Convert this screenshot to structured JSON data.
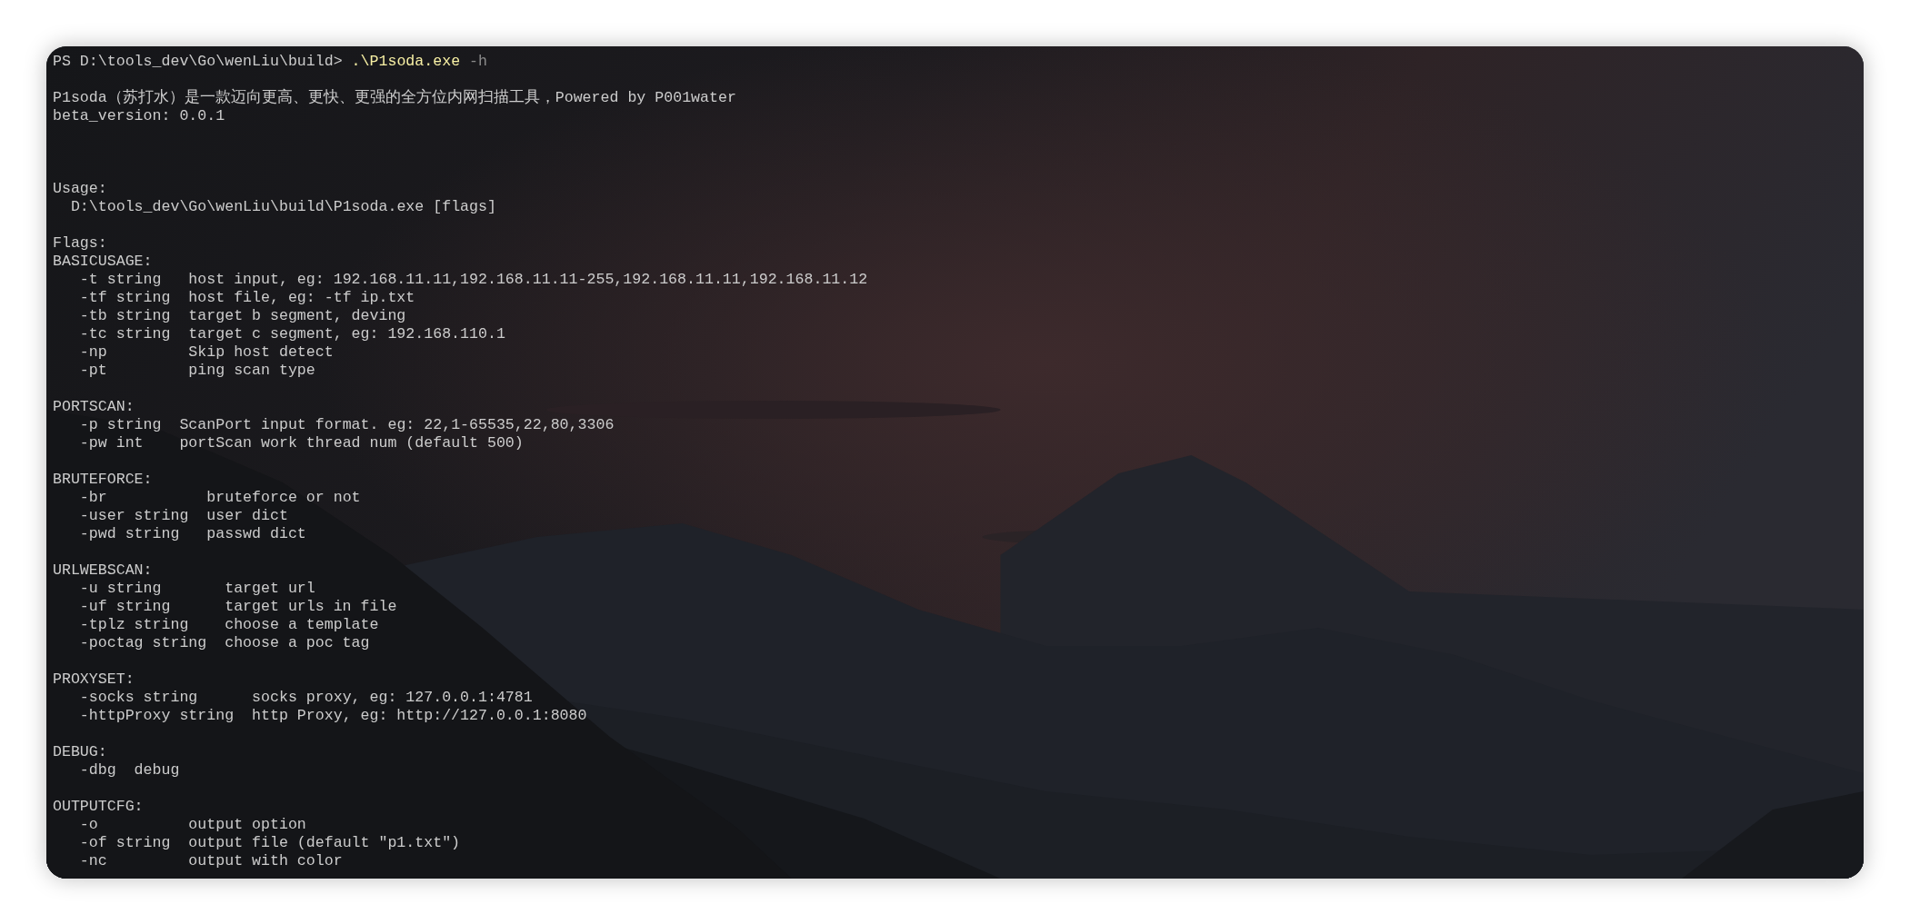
{
  "terminal": {
    "lines": [
      {
        "kind": "prompt",
        "prompt": "PS D:\\tools_dev\\Go\\wenLiu\\build>",
        "command": ".\\P1soda.exe",
        "args": "-h"
      },
      {
        "kind": "blank"
      },
      {
        "kind": "text",
        "text": "P1soda（苏打水）是一款迈向更高、更快、更强的全方位内网扫描工具，Powered by P001water"
      },
      {
        "kind": "text",
        "text": "beta_version: 0.0.1"
      },
      {
        "kind": "blank"
      },
      {
        "kind": "blank"
      },
      {
        "kind": "blank"
      },
      {
        "kind": "text",
        "text": "Usage:"
      },
      {
        "kind": "indented",
        "text": "D:\\tools_dev\\Go\\wenLiu\\build\\P1soda.exe [flags]"
      },
      {
        "kind": "blank"
      },
      {
        "kind": "text",
        "text": "Flags:"
      },
      {
        "kind": "section",
        "title": "BASICUSAGE:",
        "flags": [
          {
            "flag": "-t string",
            "description": "host input, eg: 192.168.11.11,192.168.11.11-255,192.168.11.11,192.168.11.12"
          },
          {
            "flag": "-tf string",
            "description": "host file, eg: -tf ip.txt"
          },
          {
            "flag": "-tb string",
            "description": "target b segment, deving"
          },
          {
            "flag": "-tc string",
            "description": "target c segment, eg: 192.168.110.1"
          },
          {
            "flag": "-np",
            "description": "Skip host detect"
          },
          {
            "flag": "-pt",
            "description": "ping scan type"
          }
        ]
      },
      {
        "kind": "blank"
      },
      {
        "kind": "section",
        "title": "PORTSCAN:",
        "flags": [
          {
            "flag": "-p string",
            "description": "ScanPort input format. eg: 22,1-65535,22,80,3306"
          },
          {
            "flag": "-pw int",
            "description": "portScan work thread num (default 500)"
          }
        ]
      },
      {
        "kind": "blank"
      },
      {
        "kind": "section",
        "title": "BRUTEFORCE:",
        "flags": [
          {
            "flag": "-br",
            "description": "bruteforce or not"
          },
          {
            "flag": "-user string",
            "description": "user dict"
          },
          {
            "flag": "-pwd string",
            "description": "passwd dict"
          }
        ]
      },
      {
        "kind": "blank"
      },
      {
        "kind": "section",
        "title": "URLWEBSCAN:",
        "flags": [
          {
            "flag": "-u string",
            "description": "target url"
          },
          {
            "flag": "-uf string",
            "description": "target urls in file"
          },
          {
            "flag": "-tplz string",
            "description": "choose a template"
          },
          {
            "flag": "-poctag string",
            "description": "choose a poc tag"
          }
        ]
      },
      {
        "kind": "blank"
      },
      {
        "kind": "section",
        "title": "PROXYSET:",
        "flags": [
          {
            "flag": "-socks string",
            "description": "socks proxy, eg: 127.0.0.1:4781"
          },
          {
            "flag": "-httpProxy string",
            "description": "http Proxy, eg: http://127.0.0.1:8080"
          }
        ]
      },
      {
        "kind": "blank"
      },
      {
        "kind": "section",
        "title": "DEBUG:",
        "flags": [
          {
            "flag": "-dbg",
            "description": "debug"
          }
        ]
      },
      {
        "kind": "blank"
      },
      {
        "kind": "section",
        "title": "OUTPUTCFG:",
        "flags": [
          {
            "flag": "-o",
            "description": "output option"
          },
          {
            "flag": "-of string",
            "description": "output file (default \"p1.txt\")"
          },
          {
            "flag": "-nc",
            "description": "output with color"
          }
        ]
      }
    ]
  }
}
